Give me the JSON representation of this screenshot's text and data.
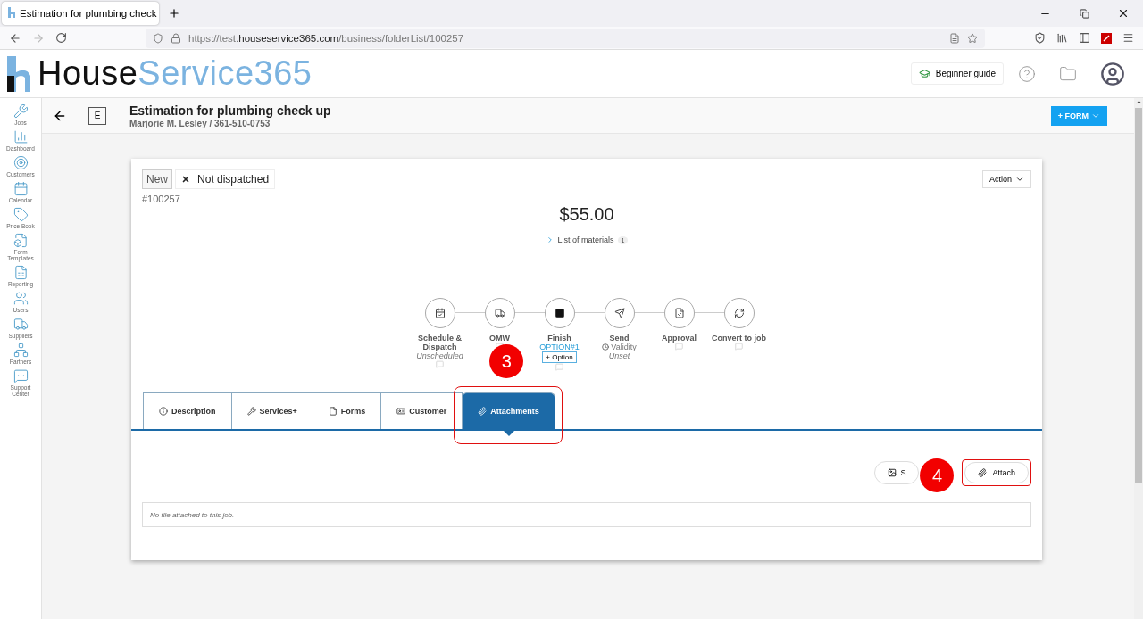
{
  "browser": {
    "tab_title": "Estimation for plumbing check",
    "url_prefix": "https://test.",
    "url_domain": "houseservice365.com",
    "url_path": "/business/folderList/100257"
  },
  "logo": {
    "first": "House",
    "second": "Service365"
  },
  "header": {
    "guide": "Beginner guide"
  },
  "sidebar": [
    {
      "kind": "jobs",
      "label": "Jobs"
    },
    {
      "kind": "dashboard",
      "label": "Dashboard"
    },
    {
      "kind": "customers",
      "label": "Customers"
    },
    {
      "kind": "calendar",
      "label": "Calendar"
    },
    {
      "kind": "pricebook",
      "label": "Price Book"
    },
    {
      "kind": "forms",
      "label": "Form Templates"
    },
    {
      "kind": "reporting",
      "label": "Reporting"
    },
    {
      "kind": "users",
      "label": "Users"
    },
    {
      "kind": "suppliers",
      "label": "Suppliers"
    },
    {
      "kind": "partners",
      "label": "Partners"
    },
    {
      "kind": "support",
      "label": "Support Center"
    }
  ],
  "job": {
    "badge": "E",
    "title": "Estimation for plumbing check up",
    "subtitle": "Marjorie M. Lesley / 361-510-0753",
    "form_button": "+ FORM"
  },
  "card": {
    "status": "New",
    "dispatch": "Not dispatched",
    "number": "#100257",
    "action": "Action",
    "total": "$55.00",
    "materials": "List of materials",
    "materials_count": "1"
  },
  "steps": [
    {
      "kind": "calendar",
      "label": "Schedule & Dispatch",
      "note": "Unscheduled",
      "comment": true
    },
    {
      "kind": "truck",
      "label": "OMW",
      "comment": true
    },
    {
      "kind": "stop",
      "label": "Finish",
      "link": "OPTION#1",
      "button": "+ Option",
      "comment": true
    },
    {
      "kind": "send",
      "label": "Send",
      "status": "Validity",
      "note": "Unset",
      "comment": false
    },
    {
      "kind": "approval",
      "label": "Approval",
      "comment": true
    },
    {
      "kind": "convert",
      "label": "Convert to job",
      "comment": true
    }
  ],
  "tabs": [
    {
      "kind": "info",
      "label": "Description",
      "selected": false
    },
    {
      "kind": "wrench",
      "label": "Services+",
      "selected": false
    },
    {
      "kind": "file",
      "label": "Forms",
      "selected": false
    },
    {
      "kind": "card",
      "label": "Customer",
      "selected": false
    },
    {
      "kind": "clip",
      "label": "Attachments",
      "selected": true,
      "callout": "3"
    }
  ],
  "attach": {
    "secondary": "S",
    "button": "Attach",
    "callout": "4",
    "empty": "No file attached to this job."
  }
}
